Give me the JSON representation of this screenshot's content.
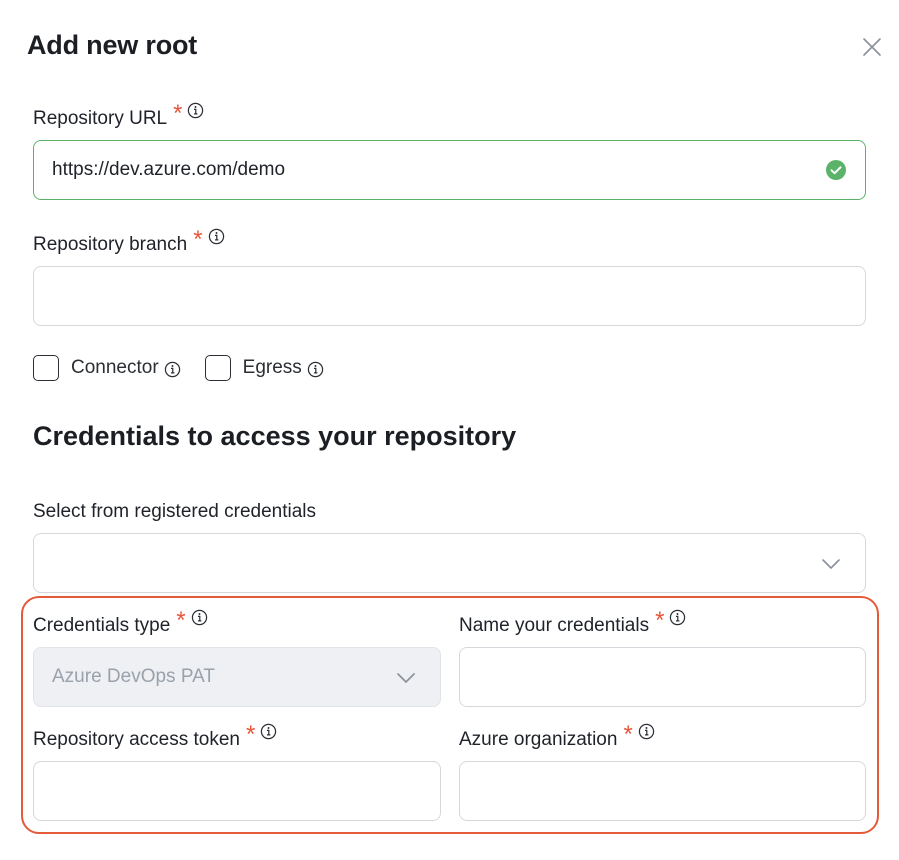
{
  "dialog": {
    "title": "Add new root",
    "close_icon": "close-icon"
  },
  "repository_url": {
    "label": "Repository URL",
    "required_mark": "*",
    "value": "https://dev.azure.com/demo",
    "status": "valid"
  },
  "repository_branch": {
    "label": "Repository branch",
    "required_mark": "*",
    "value": ""
  },
  "options": {
    "connector": {
      "label": "Connector",
      "checked": false
    },
    "egress": {
      "label": "Egress",
      "checked": false
    }
  },
  "credentials": {
    "section_title": "Credentials to access your repository",
    "registered": {
      "label": "Select from registered credentials",
      "value": ""
    },
    "type": {
      "label": "Credentials type",
      "required_mark": "*",
      "value": "Azure DevOps PAT"
    },
    "name": {
      "label": "Name your credentials",
      "required_mark": "*",
      "value": ""
    },
    "token": {
      "label": "Repository access token",
      "required_mark": "*",
      "value": ""
    },
    "organization": {
      "label": "Azure organization",
      "required_mark": "*",
      "value": ""
    }
  },
  "colors": {
    "required": "#e8553b",
    "valid": "#5bb36a",
    "highlight": "#e45a3a"
  }
}
